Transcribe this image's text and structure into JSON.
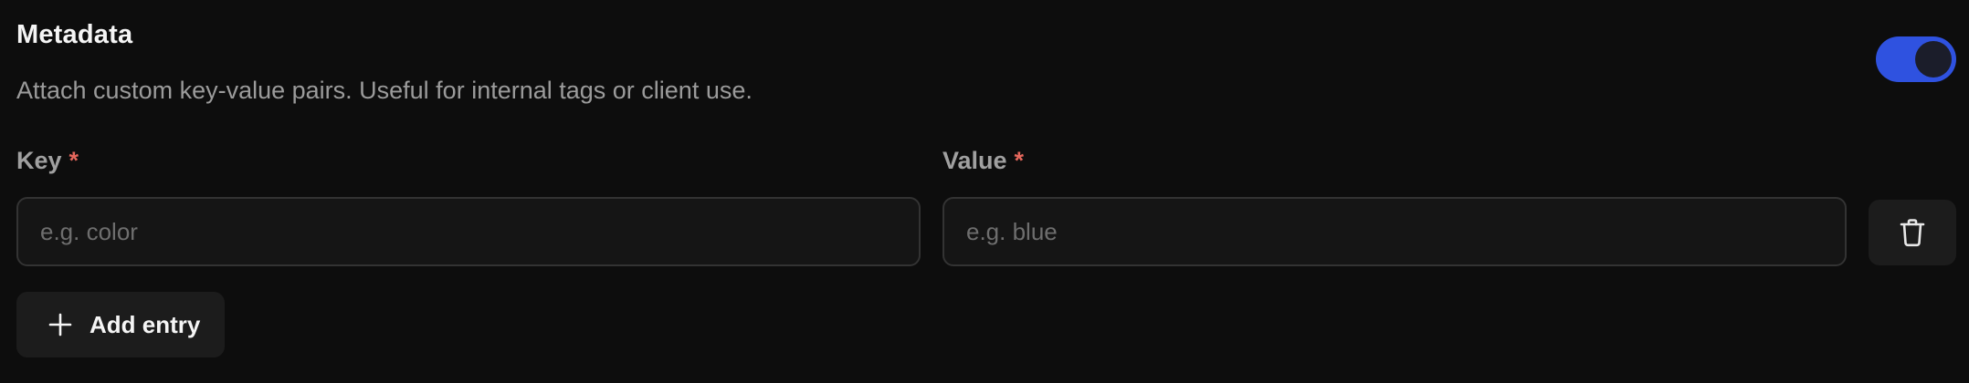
{
  "section": {
    "title": "Metadata",
    "description": "Attach custom key-value pairs. Useful for internal tags or client use.",
    "enabled": true
  },
  "fields": {
    "key": {
      "label": "Key",
      "required_mark": "*",
      "value": "",
      "placeholder": "e.g. color"
    },
    "value": {
      "label": "Value",
      "required_mark": "*",
      "value": "",
      "placeholder": "e.g. blue"
    }
  },
  "actions": {
    "delete_icon": "trash-icon",
    "add_icon": "plus-icon",
    "add_label": "Add entry"
  },
  "colors": {
    "background": "#0d0d0d",
    "accent": "#2f52e0",
    "required": "#e5675c"
  }
}
